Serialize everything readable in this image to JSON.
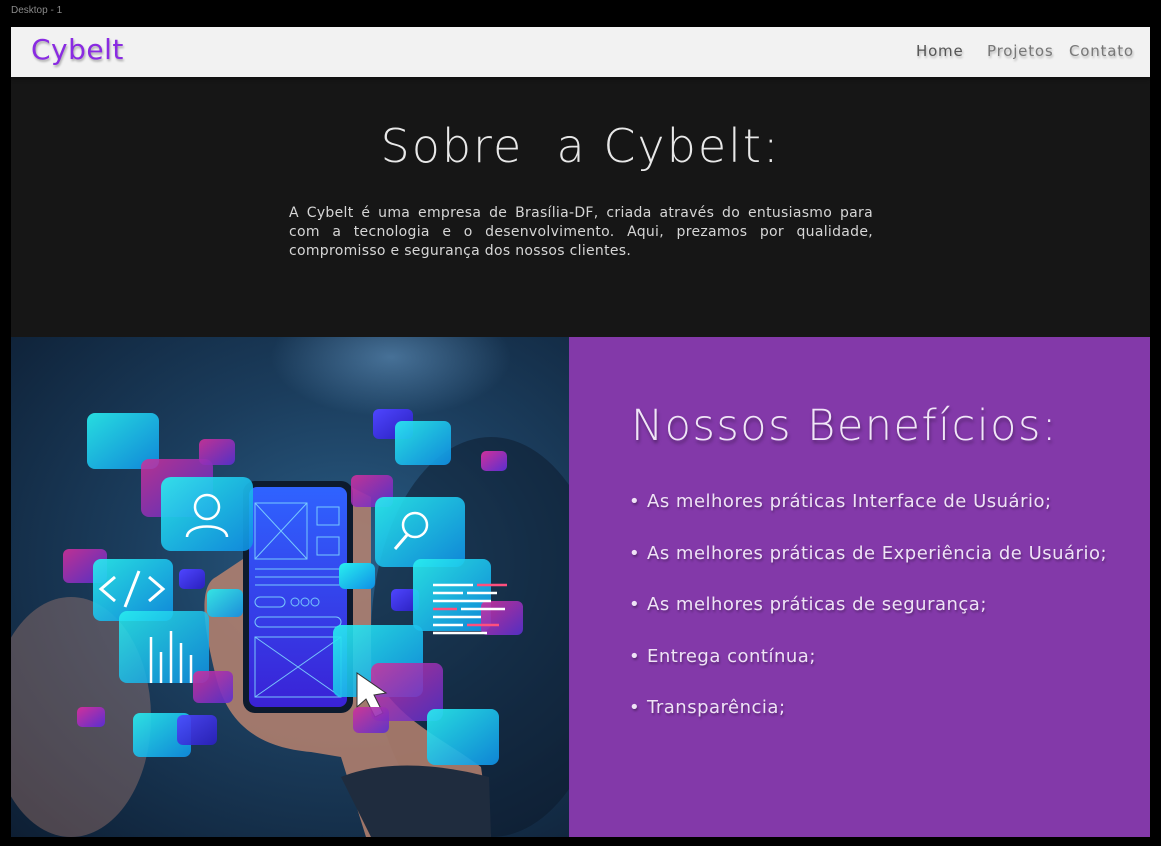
{
  "canvas_label": "Desktop - 1",
  "header": {
    "logo": "Cybelt",
    "nav": [
      {
        "label": "Home",
        "active": true
      },
      {
        "label": "Projetos",
        "active": false
      },
      {
        "label": "Contato",
        "active": false
      }
    ]
  },
  "about": {
    "title": "Sobre  a Cybelt:",
    "text": "A Cybelt é uma empresa de Brasília-DF, criada através do entusiasmo para com a tecnologia e o desenvolvimento. Aqui, prezamos por qualidade, compromisso e segurança dos nossos clientes."
  },
  "benefits": {
    "title": "Nossos Benefícios:",
    "bullet": "•",
    "items": [
      "As melhores práticas Interface de Usuário;",
      "As melhores práticas de Experiência de Usuário;",
      "As melhores práticas de segurança;",
      "Entrega contínua;",
      "Transparência;"
    ]
  },
  "colors": {
    "brand_purple": "#8a2be2",
    "benefits_background": "#8339a9",
    "page_background": "#161616",
    "header_background": "#f2f2f2"
  }
}
